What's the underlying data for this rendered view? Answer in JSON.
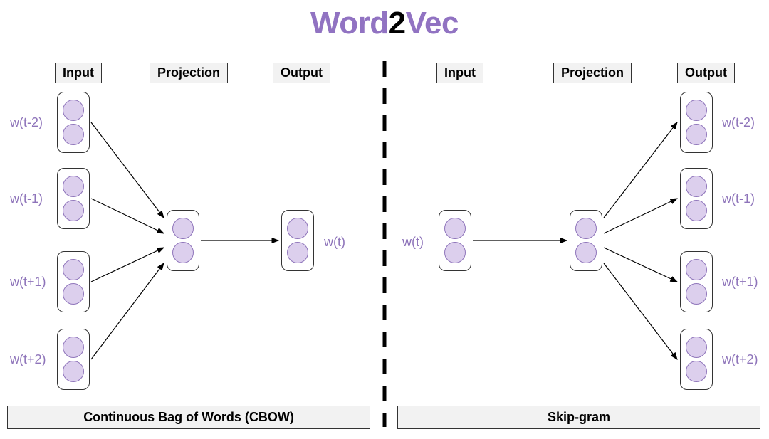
{
  "title": {
    "part1": "Word",
    "part2": "2",
    "part3": "Vec"
  },
  "columns": {
    "input": "Input",
    "projection": "Projection",
    "output": "Output"
  },
  "cbow": {
    "name": "Continuous Bag of Words (CBOW)",
    "inputs": [
      "w(t-2)",
      "w(t-1)",
      "w(t+1)",
      "w(t+2)"
    ],
    "output": "w(t)"
  },
  "skipgram": {
    "name": "Skip-gram",
    "input": "w(t)",
    "outputs": [
      "w(t-2)",
      "w(t-1)",
      "w(t+1)",
      "w(t+2)"
    ]
  },
  "colors": {
    "accent": "#9173c2",
    "neuron_fill": "#dccfed",
    "neuron_stroke": "#8e74ba"
  }
}
